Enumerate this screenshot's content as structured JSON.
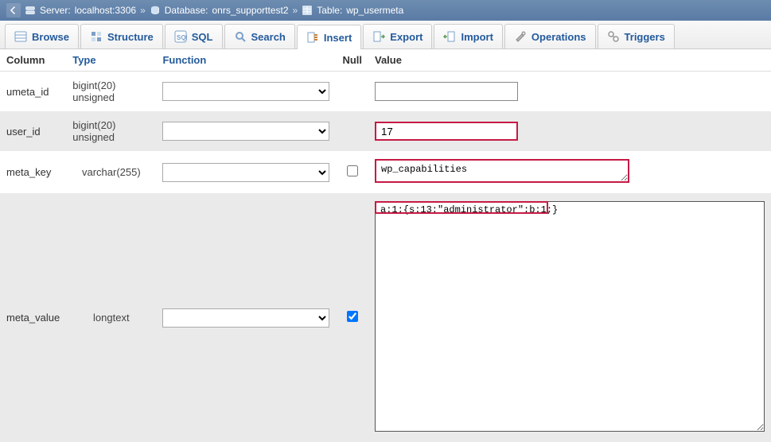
{
  "breadcrumb": {
    "server_label": "Server:",
    "server_value": "localhost:3306",
    "database_label": "Database:",
    "database_value": "onrs_supporttest2",
    "table_label": "Table:",
    "table_value": "wp_usermeta",
    "sep": "»"
  },
  "tabs": [
    {
      "label": "Browse",
      "icon_name": "browse-icon"
    },
    {
      "label": "Structure",
      "icon_name": "structure-icon"
    },
    {
      "label": "SQL",
      "icon_name": "sql-icon"
    },
    {
      "label": "Search",
      "icon_name": "search-icon"
    },
    {
      "label": "Insert",
      "icon_name": "insert-icon",
      "active": true
    },
    {
      "label": "Export",
      "icon_name": "export-icon"
    },
    {
      "label": "Import",
      "icon_name": "import-icon"
    },
    {
      "label": "Operations",
      "icon_name": "operations-icon"
    },
    {
      "label": "Triggers",
      "icon_name": "triggers-icon"
    }
  ],
  "headers": {
    "column": "Column",
    "type": "Type",
    "function": "Function",
    "null": "Null",
    "value": "Value"
  },
  "rows": [
    {
      "column": "umeta_id",
      "type": "bigint(20) unsigned",
      "null_checkbox": false,
      "value": "",
      "kind": "input-small",
      "hl": false,
      "alt": false
    },
    {
      "column": "user_id",
      "type": "bigint(20) unsigned",
      "null_checkbox": false,
      "value": "17",
      "kind": "input-small",
      "hl": true,
      "alt": true
    },
    {
      "column": "meta_key",
      "type": "varchar(255)",
      "null_checkbox": false,
      "null_checked": false,
      "value": "wp_capabilities",
      "kind": "textarea-small",
      "hl": true,
      "alt": false
    },
    {
      "column": "meta_value",
      "type": "longtext",
      "null_checkbox": true,
      "null_checked": true,
      "value": "a:1:{s:13:\"administrator\";b:1;}",
      "kind": "textarea-large",
      "hl_firstline": true,
      "alt": true
    }
  ]
}
